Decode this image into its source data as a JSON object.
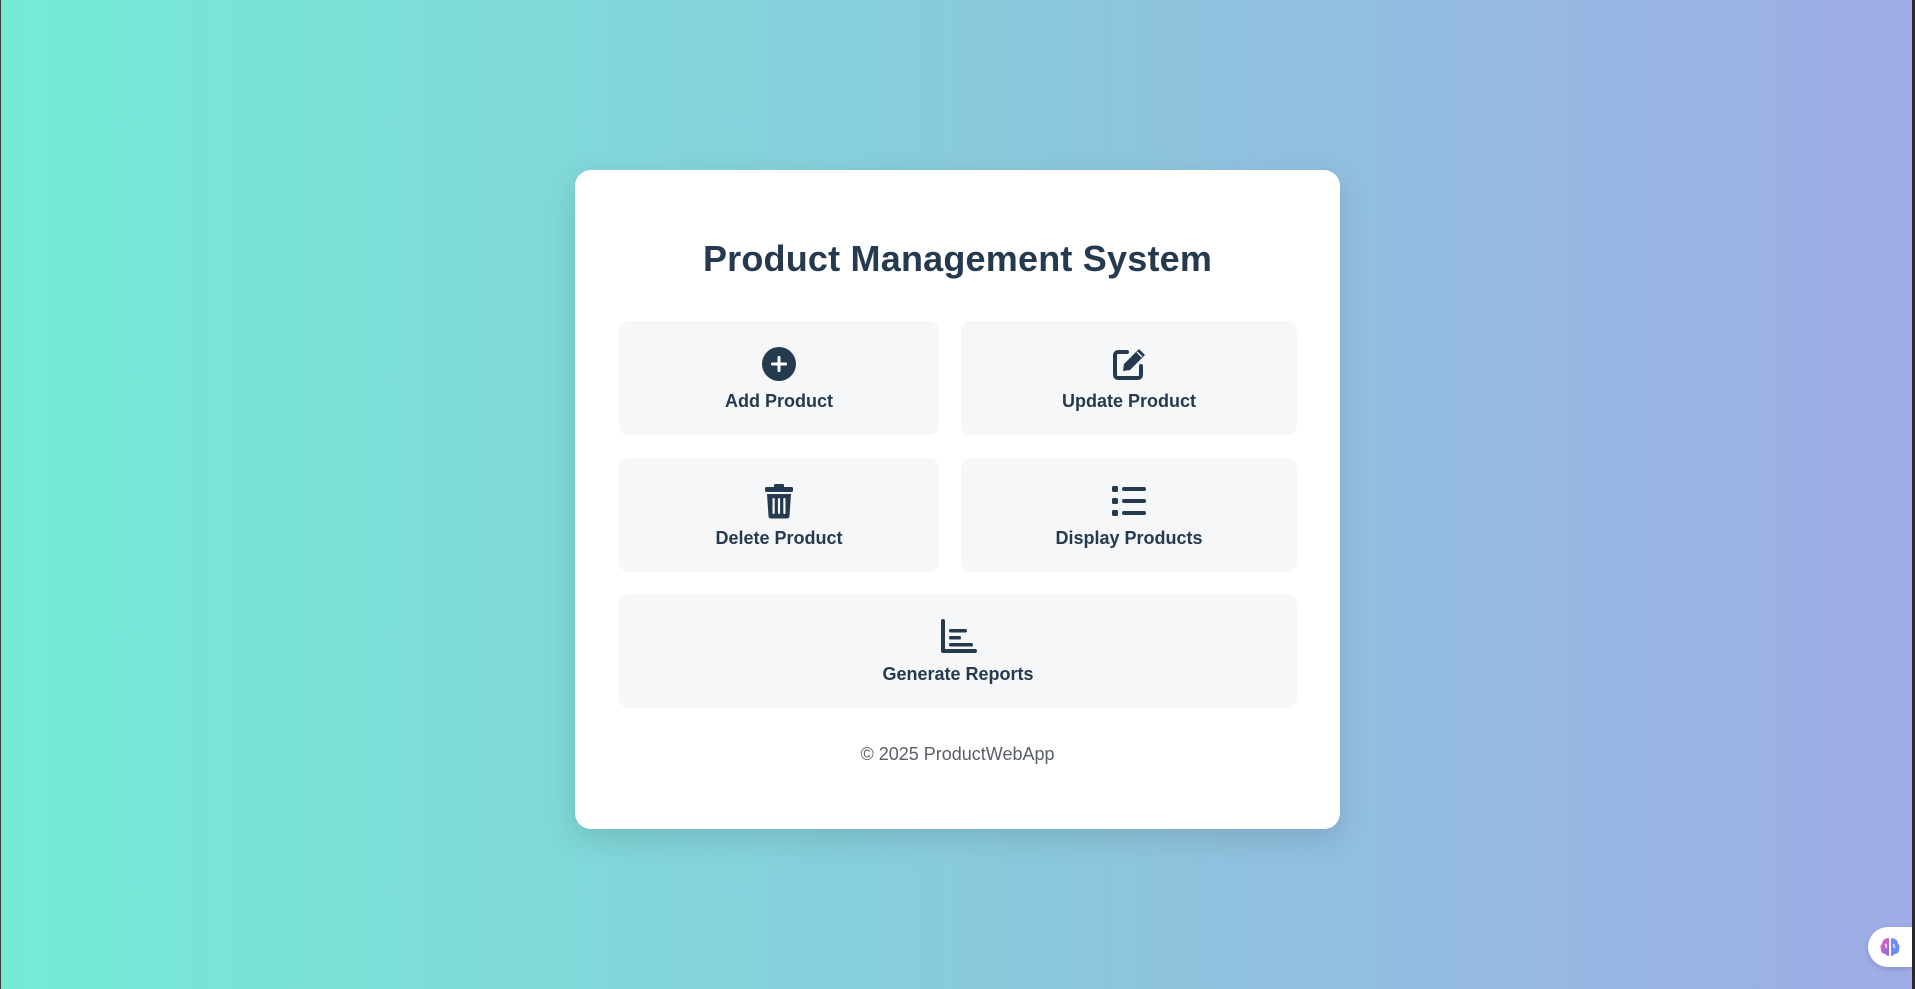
{
  "app": {
    "title": "Product Management System",
    "footer": "© 2025 ProductWebApp"
  },
  "actions": {
    "add": {
      "label": "Add Product",
      "icon": "plus-circle-icon"
    },
    "update": {
      "label": "Update Product",
      "icon": "edit-icon"
    },
    "delete": {
      "label": "Delete Product",
      "icon": "trash-icon"
    },
    "display": {
      "label": "Display Products",
      "icon": "list-icon"
    },
    "reports": {
      "label": "Generate Reports",
      "icon": "bar-chart-icon"
    }
  },
  "colors": {
    "background_start": "#74ebd5",
    "background_end": "#9face6",
    "card": "#ffffff",
    "tile": "#f6f7f9",
    "text": "#253a4f",
    "footer_text": "#5a5f66"
  },
  "assistant_button": {
    "icon": "brain-icon"
  }
}
